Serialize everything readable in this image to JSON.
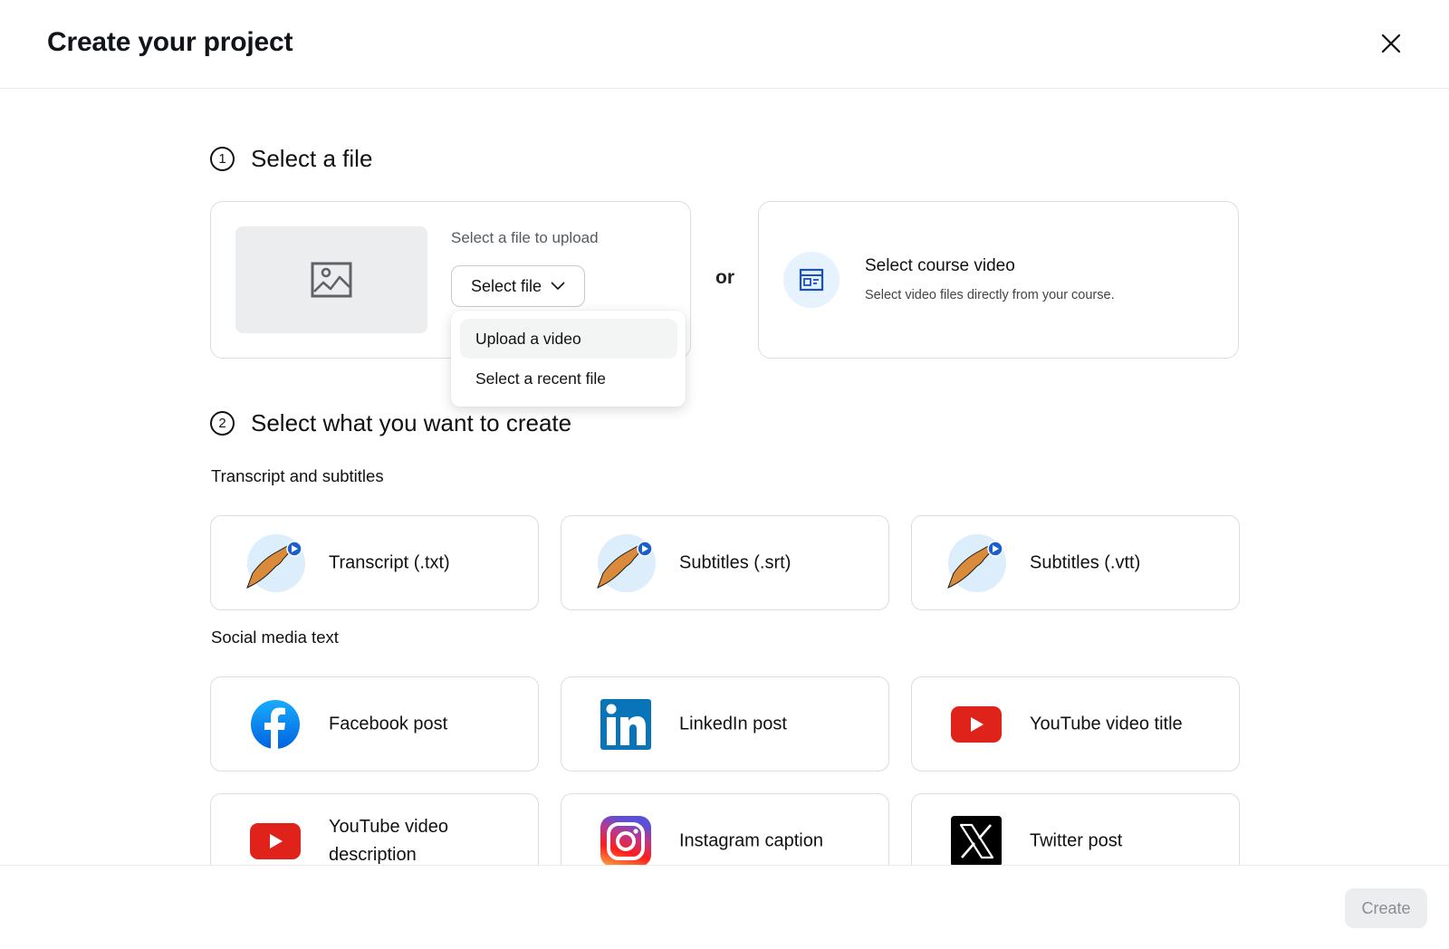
{
  "header": {
    "title": "Create your project",
    "close_icon": "close-icon"
  },
  "step1": {
    "number": "1",
    "title": "Select a file",
    "upload": {
      "hint": "Select a file to upload",
      "button_label": "Select file",
      "thumbnail_icon": "image-icon"
    },
    "or_label": "or",
    "course": {
      "title": "Select course video",
      "subtitle": "Select video files directly from your course.",
      "icon": "browser-window-icon"
    },
    "dropdown": {
      "items": [
        {
          "label": "Upload a video",
          "highlighted": true
        },
        {
          "label": "Select a recent file",
          "highlighted": false
        }
      ]
    }
  },
  "step2": {
    "number": "2",
    "title": "Select what you want to create",
    "groups": [
      {
        "label": "Transcript and subtitles",
        "options": [
          {
            "label": "Transcript (.txt)",
            "icon": "hand-holding-play-icon"
          },
          {
            "label": "Subtitles (.srt)",
            "icon": "hand-holding-play-icon"
          },
          {
            "label": "Subtitles (.vtt)",
            "icon": "hand-holding-play-icon"
          }
        ]
      },
      {
        "label": "Social media text",
        "options": [
          {
            "label": "Facebook post",
            "icon": "facebook-icon"
          },
          {
            "label": "LinkedIn post",
            "icon": "linkedin-icon"
          },
          {
            "label": "YouTube video title",
            "icon": "youtube-icon"
          },
          {
            "label": "YouTube video description",
            "icon": "youtube-icon"
          },
          {
            "label": "Instagram caption",
            "icon": "instagram-icon"
          },
          {
            "label": "Twitter post",
            "icon": "x-twitter-icon"
          }
        ]
      }
    ]
  },
  "footer": {
    "create_label": "Create",
    "create_disabled": true
  },
  "colors": {
    "accent_blue": "#1a4fc4",
    "course_icon_bg": "#e6f2fd",
    "facebook": "#1877f2",
    "linkedin": "#0a66c2",
    "youtube": "#e62117",
    "disabled_button_bg": "#ecedef",
    "disabled_button_text": "#8a8e94"
  }
}
